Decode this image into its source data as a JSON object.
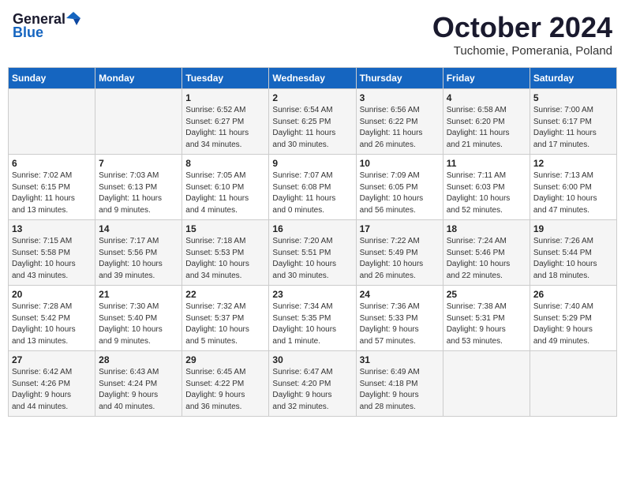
{
  "header": {
    "logo_general": "General",
    "logo_blue": "Blue",
    "month": "October 2024",
    "location": "Tuchomie, Pomerania, Poland"
  },
  "weekdays": [
    "Sunday",
    "Monday",
    "Tuesday",
    "Wednesday",
    "Thursday",
    "Friday",
    "Saturday"
  ],
  "weeks": [
    [
      {
        "day": "",
        "text": ""
      },
      {
        "day": "",
        "text": ""
      },
      {
        "day": "1",
        "text": "Sunrise: 6:52 AM\nSunset: 6:27 PM\nDaylight: 11 hours\nand 34 minutes."
      },
      {
        "day": "2",
        "text": "Sunrise: 6:54 AM\nSunset: 6:25 PM\nDaylight: 11 hours\nand 30 minutes."
      },
      {
        "day": "3",
        "text": "Sunrise: 6:56 AM\nSunset: 6:22 PM\nDaylight: 11 hours\nand 26 minutes."
      },
      {
        "day": "4",
        "text": "Sunrise: 6:58 AM\nSunset: 6:20 PM\nDaylight: 11 hours\nand 21 minutes."
      },
      {
        "day": "5",
        "text": "Sunrise: 7:00 AM\nSunset: 6:17 PM\nDaylight: 11 hours\nand 17 minutes."
      }
    ],
    [
      {
        "day": "6",
        "text": "Sunrise: 7:02 AM\nSunset: 6:15 PM\nDaylight: 11 hours\nand 13 minutes."
      },
      {
        "day": "7",
        "text": "Sunrise: 7:03 AM\nSunset: 6:13 PM\nDaylight: 11 hours\nand 9 minutes."
      },
      {
        "day": "8",
        "text": "Sunrise: 7:05 AM\nSunset: 6:10 PM\nDaylight: 11 hours\nand 4 minutes."
      },
      {
        "day": "9",
        "text": "Sunrise: 7:07 AM\nSunset: 6:08 PM\nDaylight: 11 hours\nand 0 minutes."
      },
      {
        "day": "10",
        "text": "Sunrise: 7:09 AM\nSunset: 6:05 PM\nDaylight: 10 hours\nand 56 minutes."
      },
      {
        "day": "11",
        "text": "Sunrise: 7:11 AM\nSunset: 6:03 PM\nDaylight: 10 hours\nand 52 minutes."
      },
      {
        "day": "12",
        "text": "Sunrise: 7:13 AM\nSunset: 6:00 PM\nDaylight: 10 hours\nand 47 minutes."
      }
    ],
    [
      {
        "day": "13",
        "text": "Sunrise: 7:15 AM\nSunset: 5:58 PM\nDaylight: 10 hours\nand 43 minutes."
      },
      {
        "day": "14",
        "text": "Sunrise: 7:17 AM\nSunset: 5:56 PM\nDaylight: 10 hours\nand 39 minutes."
      },
      {
        "day": "15",
        "text": "Sunrise: 7:18 AM\nSunset: 5:53 PM\nDaylight: 10 hours\nand 34 minutes."
      },
      {
        "day": "16",
        "text": "Sunrise: 7:20 AM\nSunset: 5:51 PM\nDaylight: 10 hours\nand 30 minutes."
      },
      {
        "day": "17",
        "text": "Sunrise: 7:22 AM\nSunset: 5:49 PM\nDaylight: 10 hours\nand 26 minutes."
      },
      {
        "day": "18",
        "text": "Sunrise: 7:24 AM\nSunset: 5:46 PM\nDaylight: 10 hours\nand 22 minutes."
      },
      {
        "day": "19",
        "text": "Sunrise: 7:26 AM\nSunset: 5:44 PM\nDaylight: 10 hours\nand 18 minutes."
      }
    ],
    [
      {
        "day": "20",
        "text": "Sunrise: 7:28 AM\nSunset: 5:42 PM\nDaylight: 10 hours\nand 13 minutes."
      },
      {
        "day": "21",
        "text": "Sunrise: 7:30 AM\nSunset: 5:40 PM\nDaylight: 10 hours\nand 9 minutes."
      },
      {
        "day": "22",
        "text": "Sunrise: 7:32 AM\nSunset: 5:37 PM\nDaylight: 10 hours\nand 5 minutes."
      },
      {
        "day": "23",
        "text": "Sunrise: 7:34 AM\nSunset: 5:35 PM\nDaylight: 10 hours\nand 1 minute."
      },
      {
        "day": "24",
        "text": "Sunrise: 7:36 AM\nSunset: 5:33 PM\nDaylight: 9 hours\nand 57 minutes."
      },
      {
        "day": "25",
        "text": "Sunrise: 7:38 AM\nSunset: 5:31 PM\nDaylight: 9 hours\nand 53 minutes."
      },
      {
        "day": "26",
        "text": "Sunrise: 7:40 AM\nSunset: 5:29 PM\nDaylight: 9 hours\nand 49 minutes."
      }
    ],
    [
      {
        "day": "27",
        "text": "Sunrise: 6:42 AM\nSunset: 4:26 PM\nDaylight: 9 hours\nand 44 minutes."
      },
      {
        "day": "28",
        "text": "Sunrise: 6:43 AM\nSunset: 4:24 PM\nDaylight: 9 hours\nand 40 minutes."
      },
      {
        "day": "29",
        "text": "Sunrise: 6:45 AM\nSunset: 4:22 PM\nDaylight: 9 hours\nand 36 minutes."
      },
      {
        "day": "30",
        "text": "Sunrise: 6:47 AM\nSunset: 4:20 PM\nDaylight: 9 hours\nand 32 minutes."
      },
      {
        "day": "31",
        "text": "Sunrise: 6:49 AM\nSunset: 4:18 PM\nDaylight: 9 hours\nand 28 minutes."
      },
      {
        "day": "",
        "text": ""
      },
      {
        "day": "",
        "text": ""
      }
    ]
  ]
}
